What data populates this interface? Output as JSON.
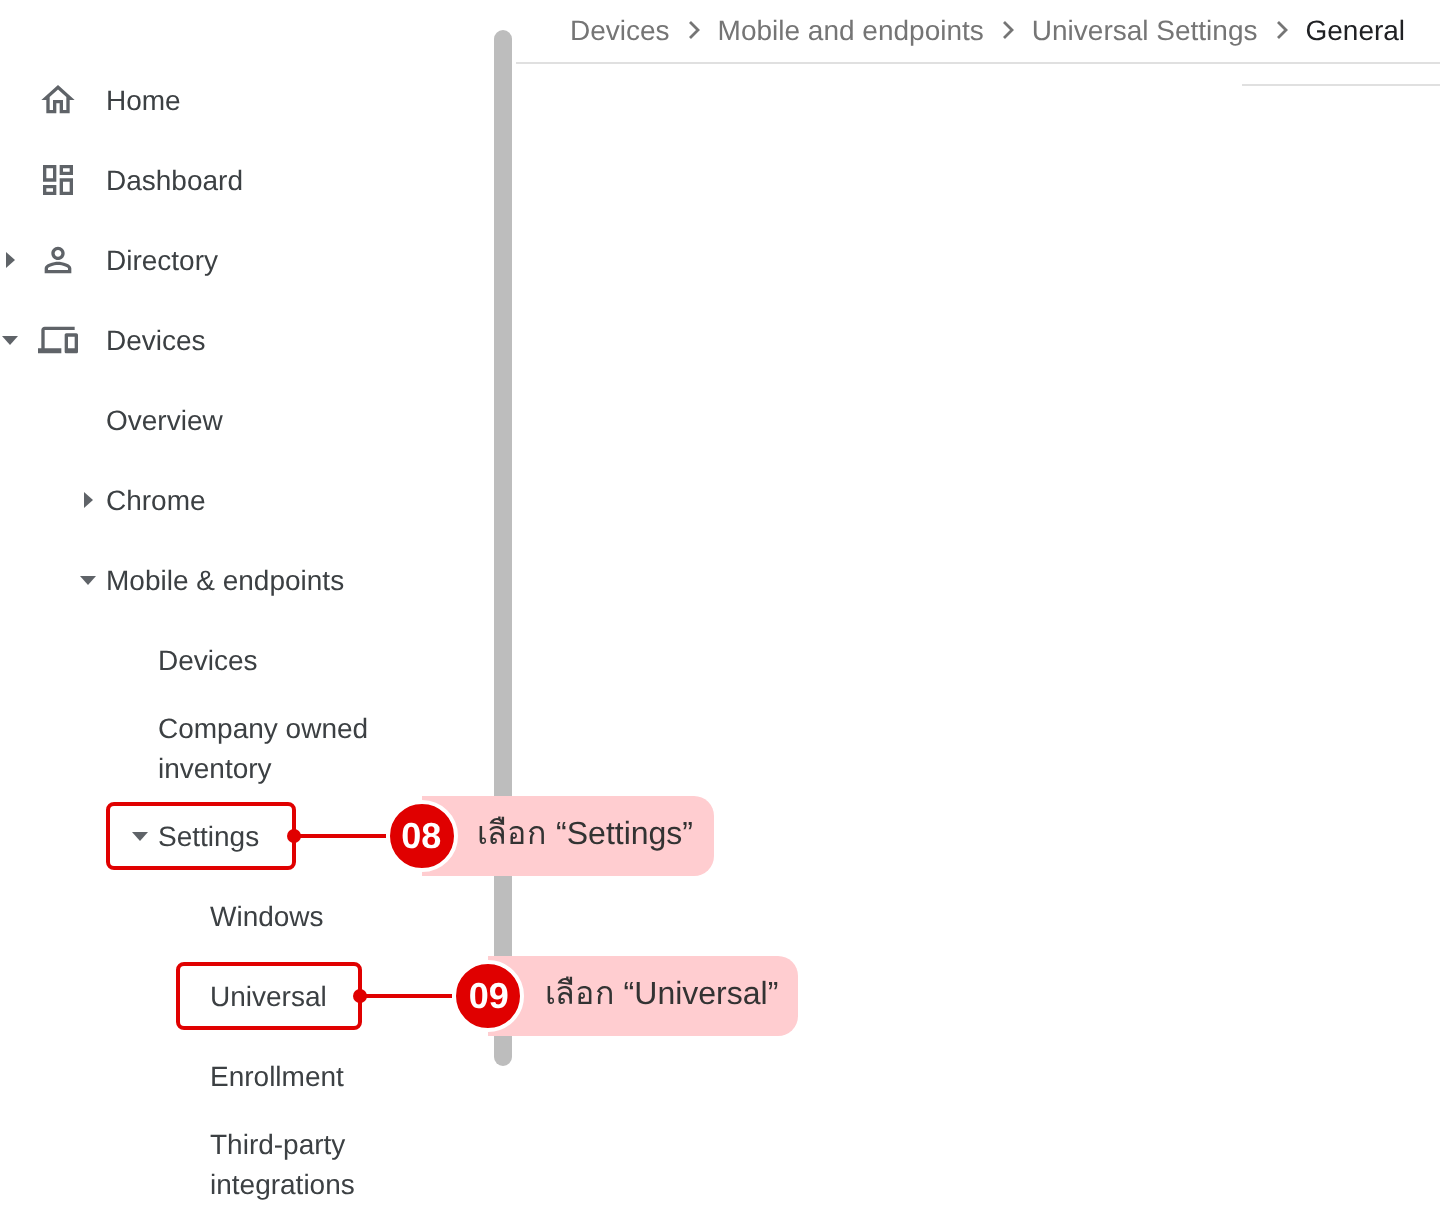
{
  "breadcrumb": [
    {
      "label": "Devices",
      "current": false
    },
    {
      "label": "Mobile and endpoints",
      "current": false
    },
    {
      "label": "Universal Settings",
      "current": false
    },
    {
      "label": "General",
      "current": true
    }
  ],
  "sidebar": {
    "items": [
      {
        "label": "Home"
      },
      {
        "label": "Dashboard"
      },
      {
        "label": "Directory",
        "expanded": false
      },
      {
        "label": "Devices",
        "expanded": true,
        "children": [
          {
            "label": "Overview"
          },
          {
            "label": "Chrome",
            "expanded": false
          },
          {
            "label": "Mobile & endpoints",
            "expanded": true,
            "children": [
              {
                "label": "Devices"
              },
              {
                "label": "Company owned inventory"
              },
              {
                "label": "Settings",
                "expanded": true,
                "callout": {
                  "number": "08",
                  "text": "เลือก “Settings”"
                },
                "children": [
                  {
                    "label": "Windows"
                  },
                  {
                    "label": "Universal",
                    "callout": {
                      "number": "09",
                      "text": "เลือก “Universal”"
                    }
                  },
                  {
                    "label": "Enrollment"
                  },
                  {
                    "label": "Third-party integrations"
                  }
                ]
              }
            ]
          }
        ]
      }
    ]
  }
}
